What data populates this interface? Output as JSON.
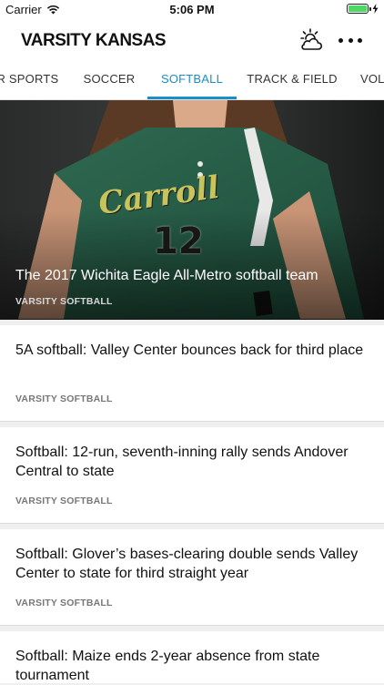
{
  "status_bar": {
    "carrier": "Carrier",
    "time": "5:06 PM",
    "battery_level": 1.0
  },
  "header": {
    "brand": "VARSITY KANSAS",
    "weather_icon": "partly-cloudy-icon",
    "more_icon": "more-horizontal-icon"
  },
  "tabs": [
    {
      "label": "ER SPORTS",
      "active": false
    },
    {
      "label": "SOCCER",
      "active": false
    },
    {
      "label": "SOFTBALL",
      "active": true
    },
    {
      "label": "TRACK & FIELD",
      "active": false
    },
    {
      "label": "VOL",
      "active": false
    }
  ],
  "accent_color": "#1b8fc8",
  "hero": {
    "title": "The 2017 Wichita Eagle All-Metro softball team",
    "section": "VARSITY SOFTBALL",
    "image": {
      "jersey_script": "Carroll",
      "jersey_number": "12"
    }
  },
  "articles": [
    {
      "title": "5A softball: Valley Center bounces back for third place",
      "section": "VARSITY SOFTBALL"
    },
    {
      "title": "Softball: 12-run, seventh-inning rally sends Andover Central to state",
      "section": "VARSITY SOFTBALL"
    },
    {
      "title": "Softball: Glover’s bases-clearing double sends Valley Center to state for third straight year",
      "section": "VARSITY SOFTBALL"
    },
    {
      "title": "Softball: Maize ends 2-year absence from state tournament",
      "section": ""
    }
  ]
}
